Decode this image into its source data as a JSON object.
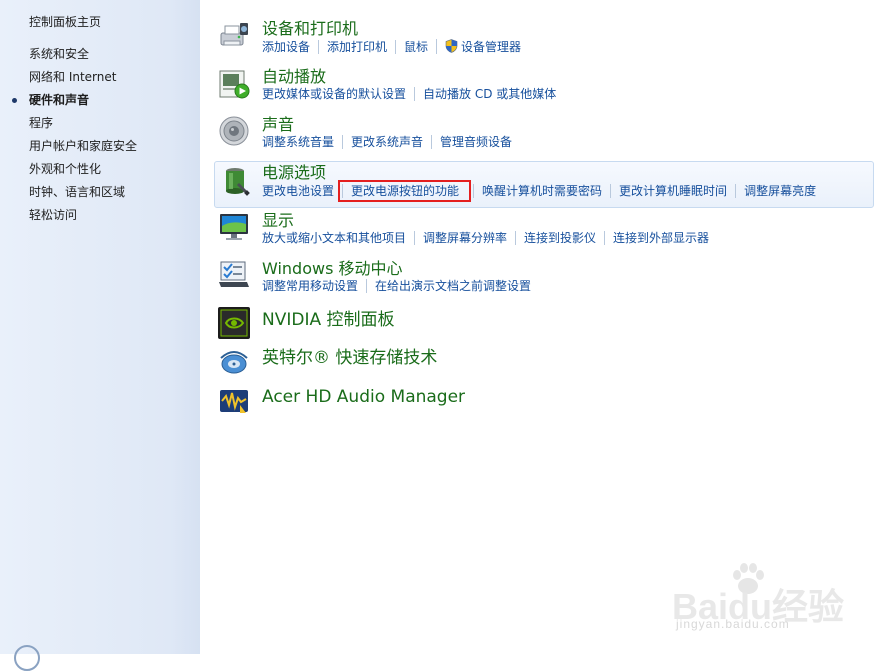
{
  "sidebar": {
    "home": "控制面板主页",
    "items": [
      {
        "label": "系统和安全",
        "active": false
      },
      {
        "label": "网络和 Internet",
        "active": false
      },
      {
        "label": "硬件和声音",
        "active": true
      },
      {
        "label": "程序",
        "active": false
      },
      {
        "label": "用户帐户和家庭安全",
        "active": false
      },
      {
        "label": "外观和个性化",
        "active": false
      },
      {
        "label": "时钟、语言和区域",
        "active": false
      },
      {
        "label": "轻松访问",
        "active": false
      }
    ]
  },
  "categories": {
    "devices": {
      "title": "设备和打印机",
      "icon": "printer-icon",
      "links": [
        "添加设备",
        "添加打印机",
        "鼠标",
        "设备管理器"
      ]
    },
    "autoplay": {
      "title": "自动播放",
      "icon": "autoplay-icon",
      "links": [
        "更改媒体或设备的默认设置",
        "自动播放 CD 或其他媒体"
      ]
    },
    "sound": {
      "title": "声音",
      "icon": "speaker-icon",
      "links": [
        "调整系统音量",
        "更改系统声音",
        "管理音频设备"
      ]
    },
    "power": {
      "title": "电源选项",
      "icon": "battery-icon",
      "highlighted": true,
      "links": [
        "更改电池设置",
        "更改电源按钮的功能",
        "唤醒计算机时需要密码",
        "更改计算机睡眠时间",
        "调整屏幕亮度"
      ],
      "boxed_link": "更改电源按钮的功能"
    },
    "display": {
      "title": "显示",
      "icon": "monitor-icon",
      "links": [
        "放大或缩小文本和其他项目",
        "调整屏幕分辨率",
        "连接到投影仪",
        "连接到外部显示器"
      ]
    },
    "mobility": {
      "title": "Windows 移动中心",
      "icon": "mobility-center-icon",
      "links": [
        "调整常用移动设置",
        "在给出演示文档之前调整设置"
      ]
    },
    "nvidia": {
      "title": "NVIDIA 控制面板",
      "icon": "nvidia-icon"
    },
    "intel": {
      "title": "英特尔® 快速存储技术",
      "icon": "intel-storage-icon"
    },
    "acer": {
      "title": "Acer HD Audio Manager",
      "icon": "audio-manager-icon"
    }
  },
  "watermark": {
    "brand": "Baidu经验",
    "url": "jingyan.baidu.com"
  },
  "colors": {
    "category_title": "#1a6c1a",
    "link": "#164f9c",
    "highlight_box": "#e41f1f",
    "sidebar_bg": "#dfe8f6"
  }
}
